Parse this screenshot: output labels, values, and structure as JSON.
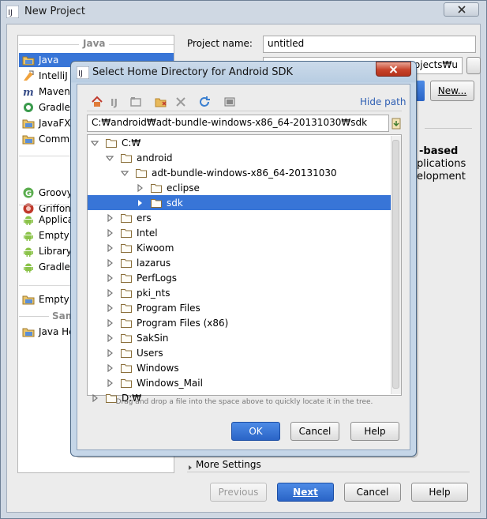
{
  "window": {
    "title": "New Project"
  },
  "left_panel": {
    "java_header": "Java",
    "items": [
      {
        "label": "Java",
        "icon": "folder-icon",
        "selected": true
      },
      {
        "label": "IntelliJ P",
        "icon": "intellij-icon"
      },
      {
        "label": "Maven",
        "icon": "maven-icon"
      },
      {
        "label": "Gradle",
        "icon": "gradle-icon"
      },
      {
        "label": "JavaFX",
        "icon": "folder-icon"
      },
      {
        "label": "Comma",
        "icon": "folder-icon"
      },
      {
        "label": "Groovy",
        "icon": "groovy-icon"
      },
      {
        "label": "Griffon",
        "icon": "griffon-icon"
      },
      {
        "label": "Applicat",
        "icon": "android-icon"
      },
      {
        "label": "Empty M",
        "icon": "android-icon"
      },
      {
        "label": "Library",
        "icon": "android-icon"
      },
      {
        "label": "Gradle:",
        "icon": "android-icon"
      },
      {
        "label": "Empty P",
        "icon": "folder-icon"
      },
      {
        "label": "Java He",
        "icon": "folder-icon"
      }
    ],
    "sam_header": "Sam"
  },
  "right_panel": {
    "project_name_label": "Project name:",
    "project_name_value": "untitled",
    "project_location_value": "ojects₩u",
    "new_button": "New...",
    "description_bold": "-based",
    "description_line2": "plications",
    "description_line3": "elopment",
    "more_settings": "More Settings"
  },
  "footer": {
    "previous": "Previous",
    "next": "Next",
    "cancel": "Cancel",
    "help": "Help"
  },
  "dialog": {
    "title": "Select Home Directory for Android SDK",
    "hide_path": "Hide path",
    "path": "C:₩android₩adt-bundle-windows-x86_64-20131030₩sdk",
    "hint": "Drag and drop a file into the space above to quickly locate it in the tree.",
    "tree": [
      {
        "label": "C:₩",
        "level": 0,
        "expanded": true
      },
      {
        "label": "android",
        "level": 1,
        "expanded": true
      },
      {
        "label": "adt-bundle-windows-x86_64-20131030",
        "level": 2,
        "expanded": true
      },
      {
        "label": "eclipse",
        "level": 3,
        "expanded": false
      },
      {
        "label": "sdk",
        "level": 3,
        "expanded": false,
        "selected": true
      },
      {
        "label": "ers",
        "level": 1,
        "expanded": false
      },
      {
        "label": "Intel",
        "level": 1,
        "expanded": false
      },
      {
        "label": "Kiwoom",
        "level": 1,
        "expanded": false
      },
      {
        "label": "lazarus",
        "level": 1,
        "expanded": false
      },
      {
        "label": "PerfLogs",
        "level": 1,
        "expanded": false
      },
      {
        "label": "pki_nts",
        "level": 1,
        "expanded": false
      },
      {
        "label": "Program Files",
        "level": 1,
        "expanded": false
      },
      {
        "label": "Program Files (x86)",
        "level": 1,
        "expanded": false
      },
      {
        "label": "SakSin",
        "level": 1,
        "expanded": false
      },
      {
        "label": "Users",
        "level": 1,
        "expanded": false
      },
      {
        "label": "Windows",
        "level": 1,
        "expanded": false
      },
      {
        "label": "Windows_Mail",
        "level": 1,
        "expanded": false
      },
      {
        "label": "D:₩",
        "level": 0,
        "expanded": false
      }
    ],
    "ok": "OK",
    "cancel": "Cancel",
    "help": "Help"
  },
  "colors": {
    "selection": "#3875d7",
    "accent_button": "#2a64c6",
    "link": "#2f5fb3"
  }
}
